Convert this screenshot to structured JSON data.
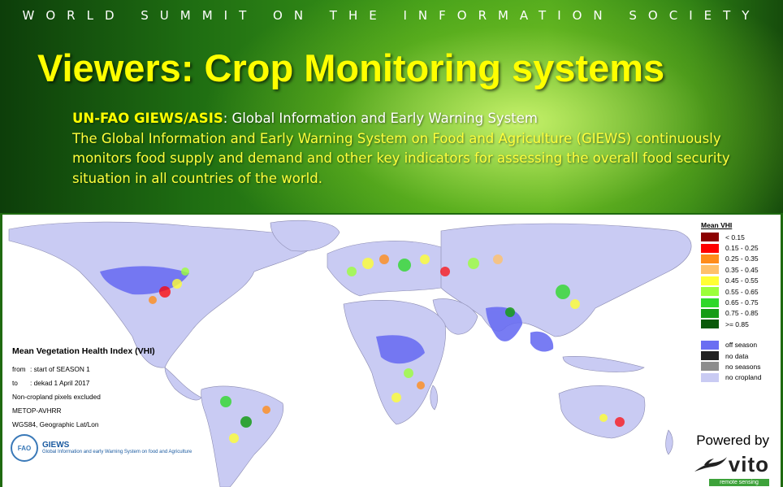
{
  "header": {
    "summit": "WORLD SUMMIT ON THE INFORMATION SOCIETY",
    "title": "Viewers: Crop Monitoring systems",
    "org_name": "UN-FAO GIEWS/ASIS",
    "org_desc": ": Global Information and Early Warning System",
    "description": "The Global Information and Early Warning System on Food and Agriculture (GIEWS) continuously monitors food supply and demand and other key indicators for assessing the overall food security situation in all countries of the world."
  },
  "map": {
    "info": {
      "title": "Mean Vegetation Health Index (VHI)",
      "from_label": "from",
      "from_value": ": start of SEASON 1",
      "to_label": "to",
      "to_value": ": dekad 1 April 2017",
      "note": "Non-cropland pixels excluded",
      "sensor": "METOP-AVHRR",
      "projection": "WGS84, Geographic Lat/Lon"
    },
    "legend": {
      "title": "Mean VHI",
      "items": [
        {
          "label": "< 0.15",
          "color": "#8b0000"
        },
        {
          "label": "0.15 - 0.25",
          "color": "#ff0000"
        },
        {
          "label": "0.25 - 0.35",
          "color": "#ff8c1a"
        },
        {
          "label": "0.35 - 0.45",
          "color": "#ffc06a"
        },
        {
          "label": "0.45 - 0.55",
          "color": "#ffff33"
        },
        {
          "label": "0.55 - 0.65",
          "color": "#9cff3a"
        },
        {
          "label": "0.65 - 0.75",
          "color": "#2fd82a"
        },
        {
          "label": "0.75 - 0.85",
          "color": "#169c16"
        },
        {
          "label": ">= 0.85",
          "color": "#0a5a0a"
        }
      ],
      "status_items": [
        {
          "label": "off season",
          "color": "#6a6ef2"
        },
        {
          "label": "no data",
          "color": "#222222"
        },
        {
          "label": "no seasons",
          "color": "#8c8c8c"
        },
        {
          "label": "no cropland",
          "color": "#c9cbf3"
        }
      ]
    },
    "giews_logo": {
      "fao": "FAO",
      "name": "GIEWS",
      "subtitle": "Global Information and early Warning System on food and Agriculture"
    },
    "powered_by": "Powered by",
    "vito_word": "vito",
    "remote_sensing": "remote sensing"
  },
  "colors": {
    "title_yellow": "#ffff00",
    "land": "#c9cbf3",
    "off_season": "#6a6ef2"
  }
}
